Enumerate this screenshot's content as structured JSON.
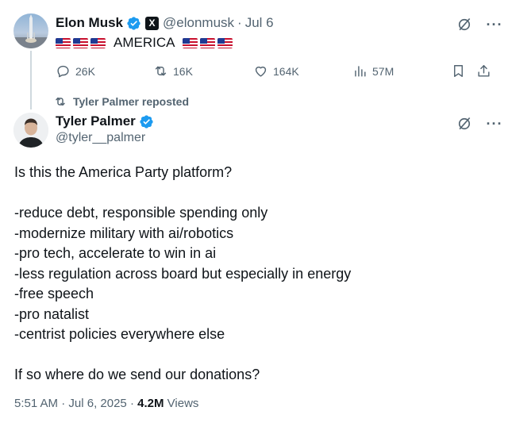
{
  "parent_tweet": {
    "author_name": "Elon Musk",
    "handle": "@elonmusk",
    "date": "Jul 6",
    "separator": "·",
    "x_badge": "X",
    "text": "AMERICA",
    "flags_before": 3,
    "flags_after": 3,
    "stats": {
      "replies": "26K",
      "reposts": "16K",
      "likes": "164K",
      "views": "57M"
    }
  },
  "repost_label": "Tyler Palmer reposted",
  "main_tweet": {
    "author_name": "Tyler Palmer",
    "handle": "@tyler__palmer",
    "intro": "Is this the America Party platform?",
    "points": [
      "-reduce debt, responsible spending only",
      "-modernize military with ai/robotics",
      "-pro tech, accelerate to win in ai",
      "-less regulation across board but especially in energy",
      "-free speech",
      "-pro natalist",
      "-centrist policies everywhere else"
    ],
    "closing": "If so where do we send our donations?",
    "time": "5:51 AM",
    "date": "Jul 6, 2025",
    "views_count": "4.2M",
    "views_label": "Views"
  },
  "colors": {
    "text": "#0f1419",
    "muted": "#536471",
    "verified": "#1d9bf0",
    "thread_line": "#cfd9de"
  },
  "icons": [
    "grok-icon",
    "more-icon",
    "reply-icon",
    "repost-icon",
    "like-icon",
    "views-icon",
    "bookmark-icon",
    "share-icon",
    "verified-icon"
  ]
}
